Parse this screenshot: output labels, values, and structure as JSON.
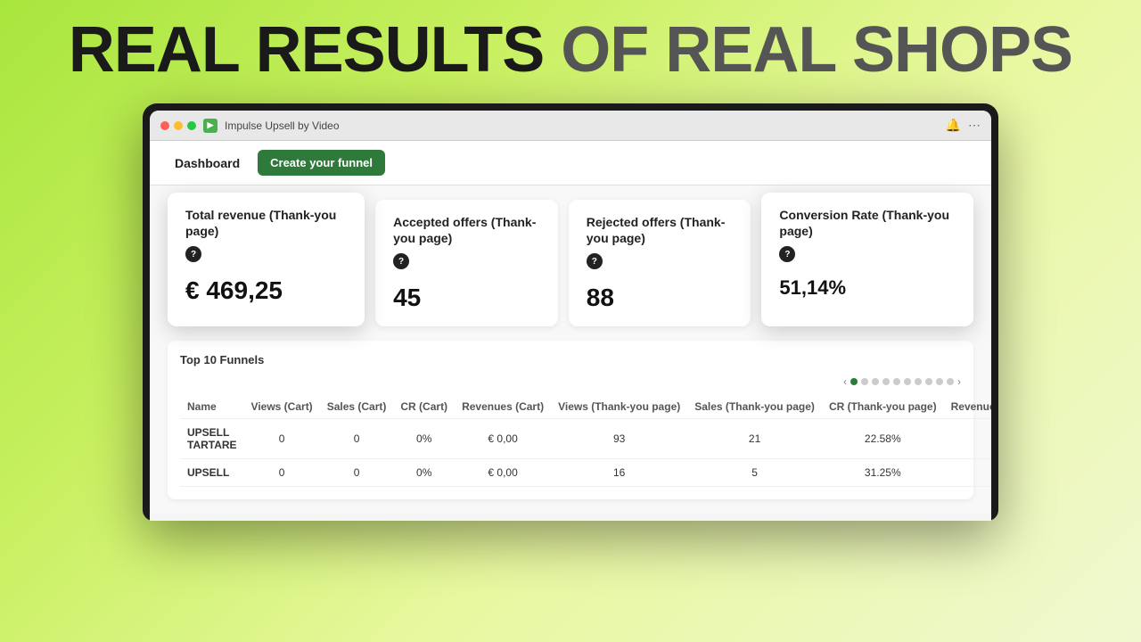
{
  "headline": {
    "bold": "REAL RESULTS",
    "separator": " OF ",
    "light": "REAL SHOPS"
  },
  "browser": {
    "appIcon": "▶",
    "appTitle": "Impulse Upsell by Video",
    "bellIcon": "🔔",
    "moreIcon": "⋯"
  },
  "nav": {
    "dashboardLabel": "Dashboard",
    "createFunnelLabel": "Create your funnel"
  },
  "stats": [
    {
      "title": "Total revenue (Thank-you page)",
      "helpTooltip": "?",
      "value": "€ 469,25"
    },
    {
      "title": "Accepted offers (Thank-you page)",
      "helpTooltip": "?",
      "value": "45"
    },
    {
      "title": "Rejected offers (Thank-you page)",
      "helpTooltip": "?",
      "value": "88"
    },
    {
      "title": "Conversion Rate (Thank-you page)",
      "helpTooltip": "?",
      "value": "51,14%"
    }
  ],
  "table": {
    "title": "Top 10 Funnels",
    "columns": [
      "Name",
      "Views (Cart)",
      "Sales (Cart)",
      "CR (Cart)",
      "Revenues (Cart)",
      "Views (Thank-you page)",
      "Sales (Thank-you page)",
      "CR (Thank-you page)",
      "Revenues"
    ],
    "rows": [
      {
        "name": "UPSELL TARTARE",
        "viewsCart": "0",
        "salesCart": "0",
        "crCart": "0%",
        "revenuesCart": "€ 0,00",
        "viewsThankyou": "93",
        "salesThankyou": "21",
        "crThankyou": "22.58%",
        "revenues": ""
      },
      {
        "name": "UPSELL",
        "viewsCart": "0",
        "salesCart": "0",
        "crCart": "0%",
        "revenuesCart": "€ 0,00",
        "viewsThankyou": "16",
        "salesThankyou": "5",
        "crThankyou": "31.25%",
        "revenues": ""
      }
    ],
    "pagination": {
      "prevLabel": "‹",
      "nextLabel": "›",
      "dots": [
        true,
        true,
        true,
        true,
        true,
        true,
        true,
        true,
        true,
        true
      ]
    }
  }
}
